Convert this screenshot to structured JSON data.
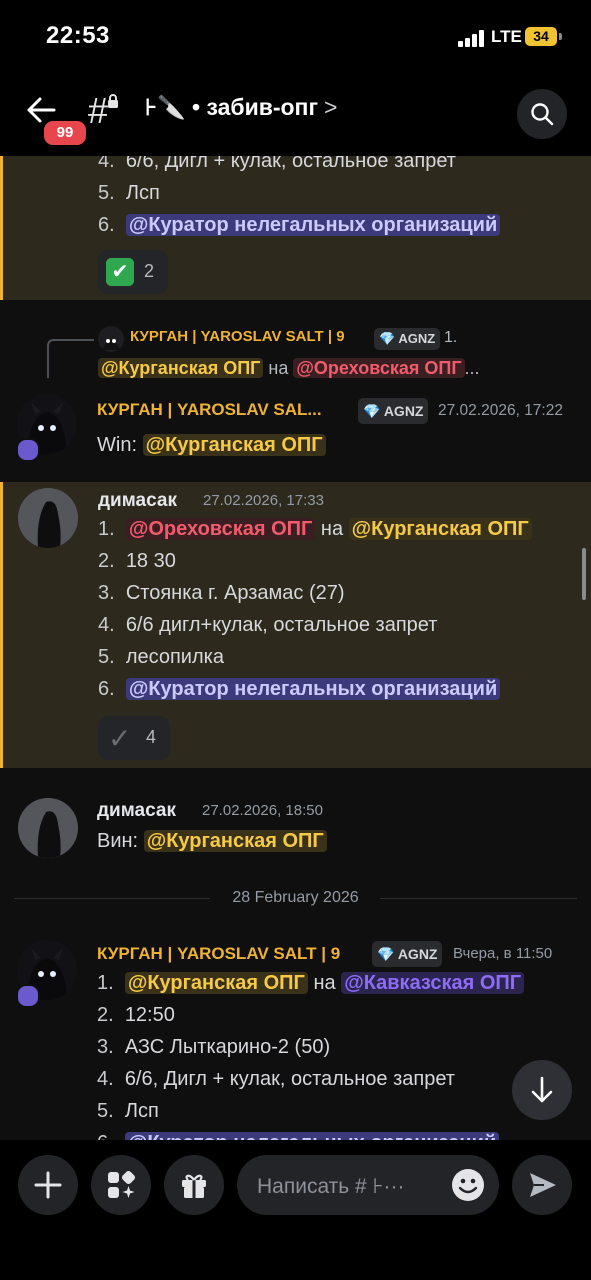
{
  "status_bar": {
    "time": "22:53",
    "network": "LTE",
    "battery": "34"
  },
  "header": {
    "unread_badge": "99",
    "channel_name": "⊦🔪 • забив-опг",
    "icons": [
      "back-arrow-icon",
      "channel-hash-lock-icon",
      "chevron-right-icon",
      "search-icon"
    ]
  },
  "messages": {
    "m1": {
      "line4": "6/6, Дигл + кулак, остальное запрет",
      "line5": "Лсп",
      "line6_mention": "@Куратор нелегальных организаций",
      "reaction_count": "2",
      "reaction_emoji": "✅"
    },
    "m2": {
      "reply_name": "КУРГАН | YAROSLAV SALT | 9",
      "reply_role": "AGNZ",
      "reply_text_start": "1.",
      "reply_mention1": "@Курганская ОПГ",
      "reply_mid": "на",
      "reply_mention2": "@Ореховская ОПГ",
      "reply_ellipsis": "...",
      "author": "КУРГАН | YAROSLAV SAL...",
      "role": "AGNZ",
      "timestamp": "27.02.2026, 17:22",
      "text_prefix": "Win:",
      "mention": "@Курганская ОПГ"
    },
    "m3": {
      "author": "димасак",
      "timestamp": "27.02.2026, 17:33",
      "line1_mention1": "@Ореховская ОПГ",
      "line1_mid": "на",
      "line1_mention2": "@Курганская ОПГ",
      "line2": "18 30",
      "line3": "Стоянка г. Арзамас (27)",
      "line4": "6/6 дигл+кулак, остальное запрет",
      "line5": "лесопилка",
      "line6_mention": "@Куратор нелегальных организаций",
      "reaction_count": "4"
    },
    "m4": {
      "author": "димасак",
      "timestamp": "27.02.2026, 18:50",
      "text_prefix": "Вин:",
      "mention": "@Курганская ОПГ"
    },
    "date_divider": "28 February 2026",
    "m5": {
      "author": "КУРГАН | YAROSLAV SALT | 9",
      "role": "AGNZ",
      "timestamp": "Вчера, в 11:50",
      "line1_mention1": "@Курганская ОПГ",
      "line1_mid": "на",
      "line1_mention2": "@Кавказская ОПГ",
      "line2": "12:50",
      "line3": "АЗС Лыткарино-2 (50)",
      "line4": "6/6, Дигл + кулак, остальное запрет",
      "line5": "Лсп",
      "line6_mention": "@Куратор нелегальных организаций"
    }
  },
  "composer": {
    "placeholder": "Написать # ⊦···"
  },
  "colors": {
    "accent_yellow": "#f7c948",
    "mention_purple": "#3c3a7a",
    "highlight_border": "#f0b232",
    "badge_red": "#e8464d"
  }
}
